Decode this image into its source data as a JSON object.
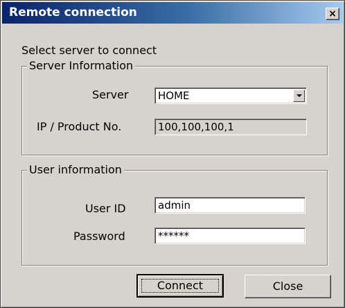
{
  "window": {
    "title": "Remote connection",
    "close_label": "×"
  },
  "prompt": "Select server to connect",
  "server_info": {
    "legend": "Server Information",
    "server_label": "Server",
    "server_value": "HOME",
    "ip_label": "IP / Product No.",
    "ip_value": "100,100,100,1"
  },
  "user_info": {
    "legend": "User information",
    "user_id_label": "User ID",
    "user_id_value": "admin",
    "password_label": "Password",
    "password_value": "******"
  },
  "buttons": {
    "connect": "Connect",
    "close": "Close"
  }
}
